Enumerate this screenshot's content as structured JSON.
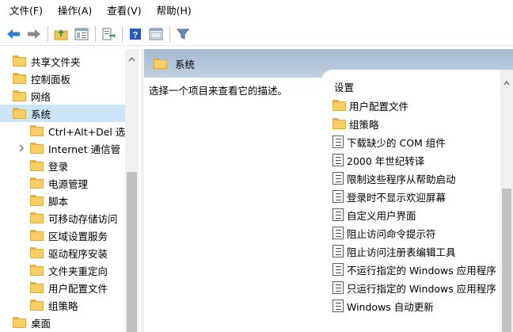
{
  "menu": [
    "文件(F)",
    "操作(A)",
    "查看(V)",
    "帮助(H)"
  ],
  "toolbar": {
    "icons": [
      "back-arrow-icon",
      "forward-arrow-icon",
      "folder-up-icon",
      "show-hide-tree-icon",
      "export-list-icon",
      "help-icon",
      "properties-icon",
      "filter-icon"
    ],
    "colors": {
      "arrow": "#2f7fd0",
      "help": "#2a5ab8",
      "filter": "#6a8bb0"
    }
  },
  "tree": {
    "items": [
      {
        "label": "共享文件夹",
        "indent": 0,
        "selected": false,
        "expandable": false
      },
      {
        "label": "控制面板",
        "indent": 0,
        "selected": false,
        "expandable": false
      },
      {
        "label": "网络",
        "indent": 0,
        "selected": false,
        "expandable": false
      },
      {
        "label": "系统",
        "indent": 0,
        "selected": true,
        "expandable": false
      },
      {
        "label": "Ctrl+Alt+Del 选",
        "indent": 1,
        "selected": false,
        "expandable": false
      },
      {
        "label": "Internet 通信管",
        "indent": 1,
        "selected": false,
        "expandable": true
      },
      {
        "label": "登录",
        "indent": 1,
        "selected": false,
        "expandable": false
      },
      {
        "label": "电源管理",
        "indent": 1,
        "selected": false,
        "expandable": false
      },
      {
        "label": "脚本",
        "indent": 1,
        "selected": false,
        "expandable": false
      },
      {
        "label": "可移动存储访问",
        "indent": 1,
        "selected": false,
        "expandable": false
      },
      {
        "label": "区域设置服务",
        "indent": 1,
        "selected": false,
        "expandable": false
      },
      {
        "label": "驱动程序安装",
        "indent": 1,
        "selected": false,
        "expandable": false
      },
      {
        "label": "文件夹重定向",
        "indent": 1,
        "selected": false,
        "expandable": false
      },
      {
        "label": "用户配置文件",
        "indent": 1,
        "selected": false,
        "expandable": false
      },
      {
        "label": "组策略",
        "indent": 1,
        "selected": false,
        "expandable": false
      },
      {
        "label": "桌面",
        "indent": 0,
        "selected": false,
        "expandable": false
      }
    ]
  },
  "right": {
    "header_title": "系统",
    "description": "选择一个项目来查看它的描述。",
    "column_header": "设置",
    "items": [
      {
        "label": "用户配置文件",
        "type": "folder"
      },
      {
        "label": "组策略",
        "type": "folder"
      },
      {
        "label": "下载缺少的 COM 组件",
        "type": "policy"
      },
      {
        "label": "2000 年世纪转译",
        "type": "policy"
      },
      {
        "label": "限制这些程序从帮助启动",
        "type": "policy"
      },
      {
        "label": "登录时不显示欢迎屏幕",
        "type": "policy"
      },
      {
        "label": "自定义用户界面",
        "type": "policy"
      },
      {
        "label": "阻止访问命令提示符",
        "type": "policy"
      },
      {
        "label": "阻止访问注册表编辑工具",
        "type": "policy"
      },
      {
        "label": "不运行指定的 Windows 应用程序",
        "type": "policy"
      },
      {
        "label": "只运行指定的 Windows 应用程序",
        "type": "policy"
      },
      {
        "label": "Windows 自动更新",
        "type": "policy"
      }
    ]
  }
}
